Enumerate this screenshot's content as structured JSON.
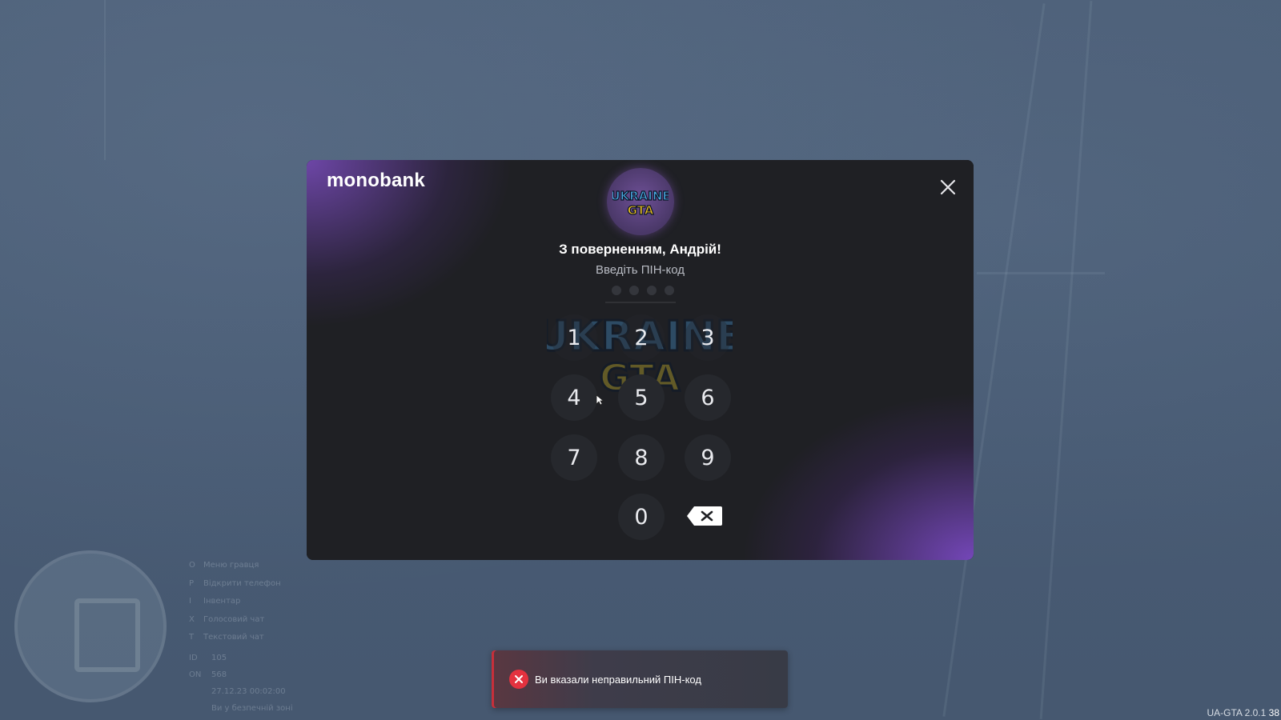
{
  "modal": {
    "brand": "monobank",
    "greeting": "З поверненням, Андрій!",
    "subtitle": "Введіть ПІН-код",
    "avatar_logo_top": "UKRAINE",
    "avatar_logo_bottom": "GTA",
    "pin_length": 4,
    "keypad": [
      "1",
      "2",
      "3",
      "4",
      "5",
      "6",
      "7",
      "8",
      "9",
      "0"
    ],
    "icons": {
      "close": "close-icon",
      "backspace": "backspace-icon"
    }
  },
  "toast": {
    "type": "error",
    "message": "Ви вказали неправильний ПІН-код",
    "color": "#e4323f"
  },
  "hud": {
    "hints": [
      {
        "key": "O",
        "label": "Меню гравця"
      },
      {
        "key": "P",
        "label": "Відкрити телефон"
      },
      {
        "key": "I",
        "label": "Інвентар"
      },
      {
        "key": "X",
        "label": "Голосовий чат"
      },
      {
        "key": "T",
        "label": "Текстовий чат"
      }
    ],
    "stats": [
      {
        "key": "ID",
        "value": "105"
      },
      {
        "key": "ON",
        "value": "568"
      },
      {
        "key": "",
        "value": "27.12.23 00:02:00"
      },
      {
        "key": "",
        "value": "Ви у безпечній зоні"
      }
    ]
  },
  "footer": {
    "version": "UA-GTA 2.0.1",
    "fps": "38"
  },
  "colors": {
    "accent_purple": "#7b4dbe",
    "modal_bg": "#1f2024",
    "error_red": "#e4323f"
  }
}
